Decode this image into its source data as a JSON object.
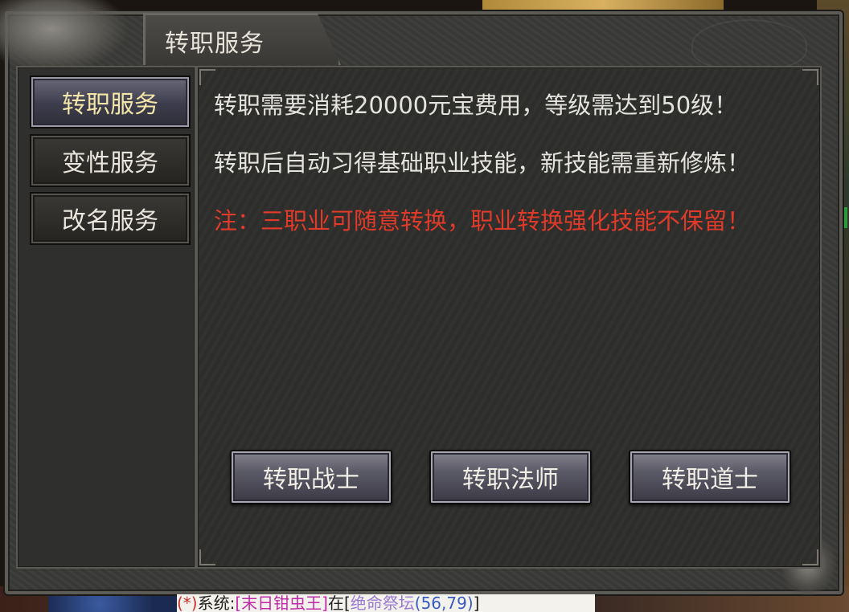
{
  "window": {
    "title": "转职服务"
  },
  "sidebar": {
    "items": [
      {
        "label": "转职服务",
        "active": true
      },
      {
        "label": "变性服务",
        "active": false
      },
      {
        "label": "改名服务",
        "active": false
      }
    ]
  },
  "content": {
    "lines": [
      "转职需要消耗20000元宝费用，等级需达到50级！",
      "转职后自动习得基础职业技能，新技能需重新修炼！",
      "注：三职业可随意转换，职业转换强化技能不保留！"
    ],
    "warning_color": "#e03a2a"
  },
  "actions": {
    "warrior": "转职战士",
    "mage": "转职法师",
    "taoist": "转职道士"
  },
  "chat": {
    "tag": "(*)",
    "system": "系统:",
    "name": "[末日钳虫王]",
    "at": "在",
    "place_open": "[",
    "place": "绝命祭坛",
    "coord": "(56,79)",
    "place_close": "]"
  }
}
